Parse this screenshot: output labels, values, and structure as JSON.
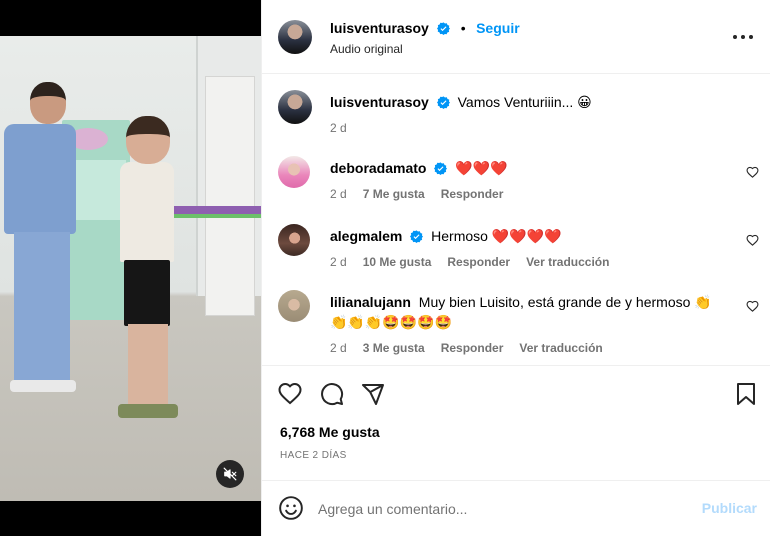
{
  "post": {
    "author": "luisventurasoy",
    "separator": "•",
    "follow_label": "Seguir",
    "audio": "Audio original"
  },
  "caption": {
    "username": "luisventurasoy",
    "text": "Vamos Venturiiin... 😀",
    "time": "2 d"
  },
  "comments": [
    {
      "username": "deboradamato",
      "verified": true,
      "text": "❤️❤️❤️",
      "time": "2 d",
      "likes": "7 Me gusta",
      "reply": "Responder",
      "translate": ""
    },
    {
      "username": "alegmalem",
      "verified": true,
      "text": "Hermoso ❤️❤️❤️❤️",
      "time": "2 d",
      "likes": "10 Me gusta",
      "reply": "Responder",
      "translate": "Ver traducción"
    },
    {
      "username": "lilianalujann",
      "verified": false,
      "text": "Muy bien Luisito, está grande de y hermoso 👏👏👏👏🤩🤩🤩🤩",
      "time": "2 d",
      "likes": "3 Me gusta",
      "reply": "Responder",
      "translate": "Ver traducción"
    }
  ],
  "stats": {
    "likes": "6,768 Me gusta",
    "ago": "HACE 2 DÍAS"
  },
  "composer": {
    "placeholder": "Agrega un comentario...",
    "publish": "Publicar"
  },
  "icons": {
    "verified": "verified-badge-icon",
    "more": "more-options-icon",
    "like": "heart-icon",
    "comment": "comment-icon",
    "share": "share-icon",
    "save": "bookmark-icon",
    "emoji": "emoji-icon",
    "mute": "muted-speaker-icon"
  },
  "colors": {
    "accent": "#0095f6",
    "publish_disabled": "#b3dbfc",
    "muted_text": "#737373",
    "heart": "#ed4956"
  }
}
